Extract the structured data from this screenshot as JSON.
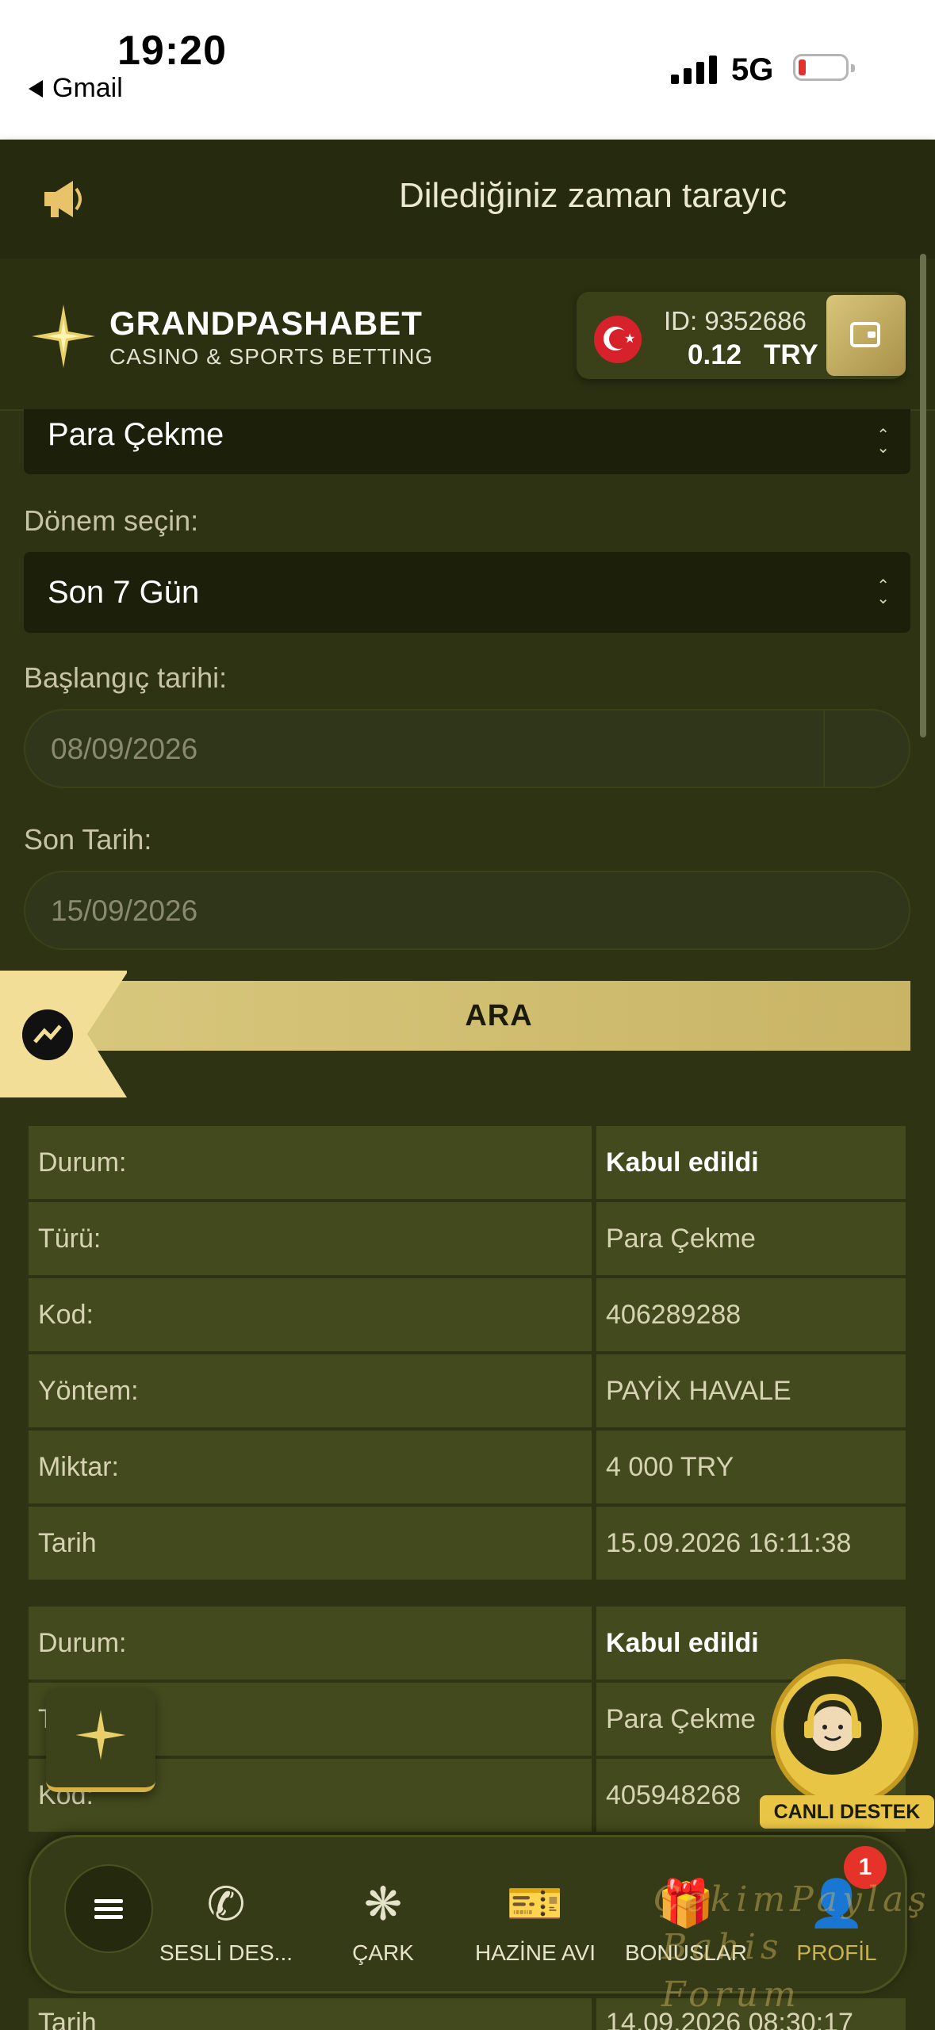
{
  "status_bar": {
    "time": "19:20",
    "back_app": "Gmail",
    "network": "5G"
  },
  "marquee": {
    "text": "Dilediğiniz zaman tarayıc",
    "icon": "megaphone-icon"
  },
  "header": {
    "brand_name": "GRANDPASHABET",
    "brand_sub": "CASINO & SPORTS BETTING",
    "account_id": "ID: 9352686",
    "balance": "0.12",
    "currency": "TRY"
  },
  "form": {
    "type_value": "Para Çekme",
    "period_label": "Dönem seçin:",
    "period_value": "Son 7 Gün",
    "start_label": "Başlangıç tarihi:",
    "start_value": "08/09/2026",
    "end_label": "Son Tarih:",
    "end_value": "15/09/2026",
    "search_label": "ARA"
  },
  "transactions": [
    {
      "rows": [
        {
          "key": "Durum:",
          "value": "Kabul edildi"
        },
        {
          "key": "Türü:",
          "value": "Para Çekme"
        },
        {
          "key": "Kod:",
          "value": "406289288"
        },
        {
          "key": "Yöntem:",
          "value": "PAYİX HAVALE"
        },
        {
          "key": "Miktar:",
          "value": "4 000 TRY"
        },
        {
          "key": "Tarih",
          "value": "15.09.2026 16:11:38"
        }
      ]
    },
    {
      "rows": [
        {
          "key": "Durum:",
          "value": "Kabul edildi"
        },
        {
          "key": "Türü:",
          "value": "Para Çekme"
        },
        {
          "key": "Kod:",
          "value": "405948268"
        }
      ],
      "last_row": {
        "key": "Tarih",
        "value": "14.09.2026 08:30:17"
      }
    }
  ],
  "support": {
    "label": "CANLI DESTEK"
  },
  "bottom_nav": {
    "items": [
      {
        "label": "SESLİ DES...",
        "icon": "phone-icon"
      },
      {
        "label": "ÇARK",
        "icon": "wheel-icon"
      },
      {
        "label": "HAZİNE AVI",
        "icon": "treasure-ticket-icon"
      },
      {
        "label": "BONUSLAR",
        "icon": "gift-icon"
      },
      {
        "label": "PROFİL",
        "icon": "profile-icon"
      }
    ],
    "badge_count": "1"
  },
  "watermark": {
    "line1": "ÇekimPaylaş",
    "line2": "Bahis Forum"
  },
  "colors": {
    "accent_gold": "#d7c77c",
    "background": "#2e3313",
    "cell": "#434a1d",
    "badge": "#e6332a"
  }
}
